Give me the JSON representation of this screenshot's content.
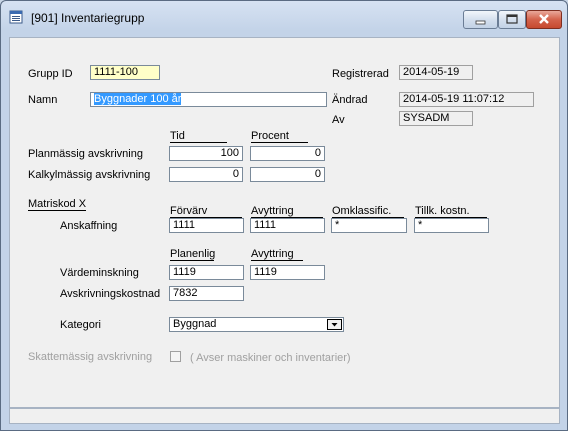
{
  "window": {
    "title": "[901]  Inventariegrupp",
    "icon": "document-list-icon"
  },
  "form": {
    "grupp_id_label": "Grupp ID",
    "grupp_id_value": "1111-100",
    "namn_label": "Namn",
    "namn_value": "Byggnader 100 år",
    "registrerad_label": "Registrerad",
    "registrerad_value": "2014-05-19",
    "andrad_label": "Ändrad",
    "andrad_value": "2014-05-19 11:07:12",
    "av_label": "Av",
    "av_value": "SYSADM"
  },
  "depreciation": {
    "tid_header": "Tid",
    "procent_header": "Procent",
    "rows": [
      {
        "label": "Planmässig avskrivning",
        "tid": "100",
        "procent": "0"
      },
      {
        "label": "Kalkylmässig avskrivning",
        "tid": "0",
        "procent": "0"
      }
    ]
  },
  "matriskod": {
    "title": "Matriskod X",
    "headers": [
      "Förvärv",
      "Avyttring",
      "Omklassific.",
      "Tillk. kostn."
    ],
    "anskaffning_label": "Anskaffning",
    "anskaffning_values": [
      "1111",
      "1111",
      "*",
      "*"
    ],
    "sub_headers": [
      "Planenlig",
      "Avyttring"
    ],
    "vardeminskning_label": "Värdeminskning",
    "vardeminskning_values": [
      "1119",
      "1119"
    ],
    "avskrivningskostnad_label": "Avskrivningskostnad",
    "avskrivningskostnad_value": "7832"
  },
  "kategori": {
    "label": "Kategori",
    "selected": "Byggnad"
  },
  "skatt": {
    "label": "Skattemässig avskrivning",
    "note": "( Avser maskiner och inventarier)"
  }
}
